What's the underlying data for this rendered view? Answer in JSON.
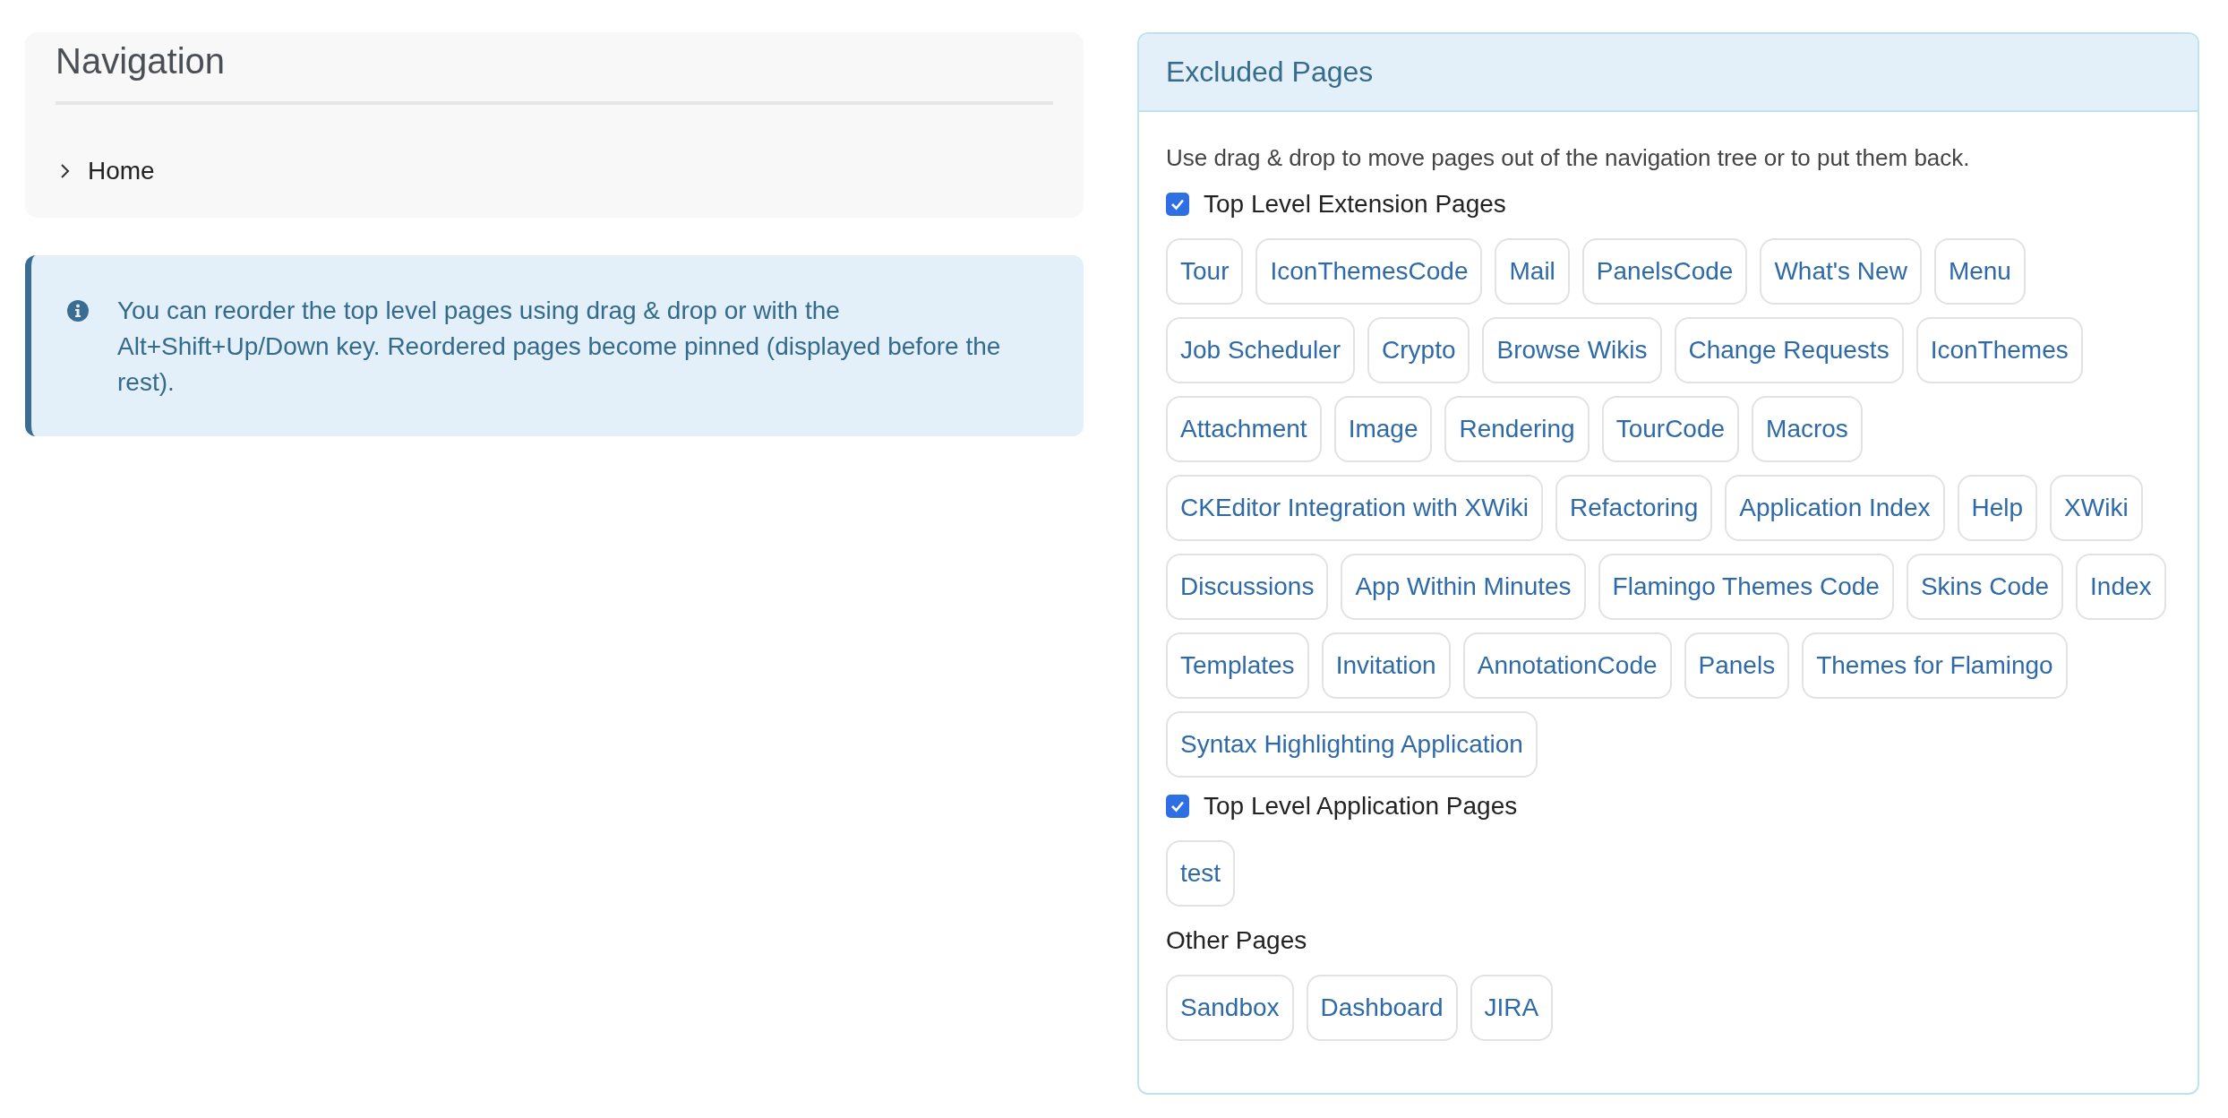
{
  "navigation": {
    "title": "Navigation",
    "tree": [
      {
        "label": "Home",
        "expanded": false
      }
    ]
  },
  "info": {
    "text": "You can reorder the top level pages using drag & drop or with the Alt+Shift+Up/Down key. Reordered pages become pinned (displayed before the rest)."
  },
  "excluded": {
    "title": "Excluded Pages",
    "hint": "Use drag & drop to move pages out of the navigation tree or to put them back.",
    "groups": [
      {
        "kind": "checkbox",
        "label": "Top Level Extension Pages",
        "checked": true,
        "pages": [
          "Tour",
          "IconThemesCode",
          "Mail",
          "PanelsCode",
          "What's New",
          "Menu",
          "Job Scheduler",
          "Crypto",
          "Browse Wikis",
          "Change Requests",
          "IconThemes",
          "Attachment",
          "Image",
          "Rendering",
          "TourCode",
          "Macros",
          "CKEditor Integration with XWiki",
          "Refactoring",
          "Application Index",
          "Help",
          "XWiki",
          "Discussions",
          "App Within Minutes",
          "Flamingo Themes Code",
          "Skins Code",
          "Index",
          "Templates",
          "Invitation",
          "AnnotationCode",
          "Panels",
          "Themes for Flamingo",
          "Syntax Highlighting Application"
        ]
      },
      {
        "kind": "checkbox",
        "label": "Top Level Application Pages",
        "checked": true,
        "pages": [
          "test"
        ]
      },
      {
        "kind": "plain",
        "label": "Other Pages",
        "pages": [
          "Sandbox",
          "Dashboard",
          "JIRA"
        ]
      }
    ]
  }
}
